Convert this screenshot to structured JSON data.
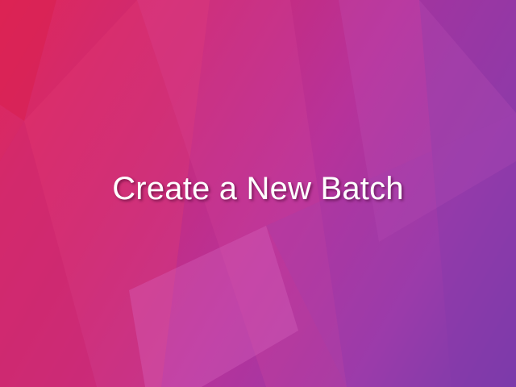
{
  "slide": {
    "title": "Create a New Batch"
  },
  "colors": {
    "gradient_start": "#e0285a",
    "gradient_mid": "#b7329a",
    "gradient_end": "#6a3aa8",
    "title_text": "#ffffff"
  }
}
